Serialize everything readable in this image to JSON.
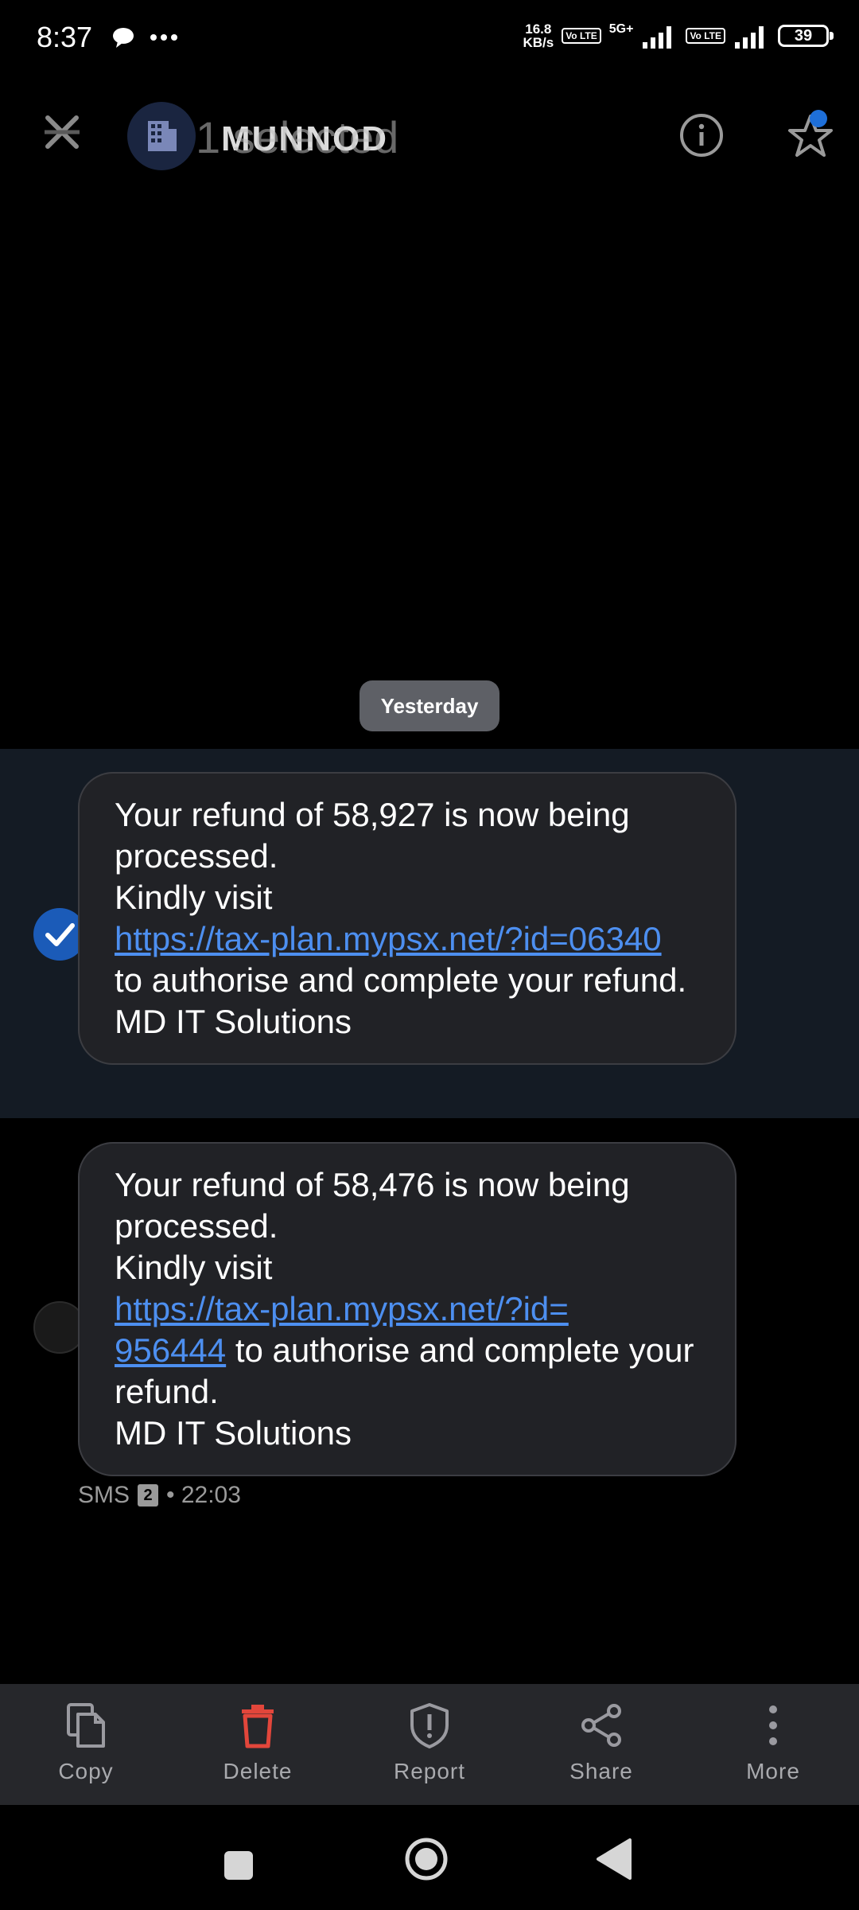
{
  "status_bar": {
    "time": "8:37",
    "net_speed_value": "16.8",
    "net_speed_unit": "KB/s",
    "network_type": "5G+",
    "volte_label": "Vo LTE",
    "battery": "39"
  },
  "app_bar": {
    "contact_name": "MUNNOD",
    "selected_label": "1 selected",
    "icons": [
      "close-icon",
      "building-avatar-icon",
      "info-icon",
      "star-icon"
    ]
  },
  "date_divider": "Yesterday",
  "messages": [
    {
      "selected": true,
      "line1": "Your refund of 58,927 is now being processed.",
      "line2": "Kindly visit",
      "link": "https://tax-plan.mypsx.net/?id=06340",
      "line3": "to authorise and complete your refund.",
      "signature": "MD IT Solutions"
    },
    {
      "selected": false,
      "line1": "Your refund of 58,476 is now being processed.",
      "line2": "Kindly visit",
      "link_part1": "https://tax-plan.mypsx.net/?id=",
      "link_part2": "956444",
      "line3": "to authorise and complete your refund.",
      "signature": "MD IT Solutions"
    }
  ],
  "message_meta": {
    "type": "SMS",
    "sim": "2",
    "time": "• 22:03"
  },
  "actions": [
    {
      "label": "Copy",
      "icon": "copy-icon"
    },
    {
      "label": "Delete",
      "icon": "delete-icon",
      "color": "#e2463b"
    },
    {
      "label": "Report",
      "icon": "report-icon"
    },
    {
      "label": "Share",
      "icon": "share-icon"
    },
    {
      "label": "More",
      "icon": "more-vert-icon"
    }
  ],
  "colors": {
    "accent": "#1b5bb8",
    "link": "#4d8ff0",
    "bubble": "#212226",
    "delete": "#e2463b"
  }
}
